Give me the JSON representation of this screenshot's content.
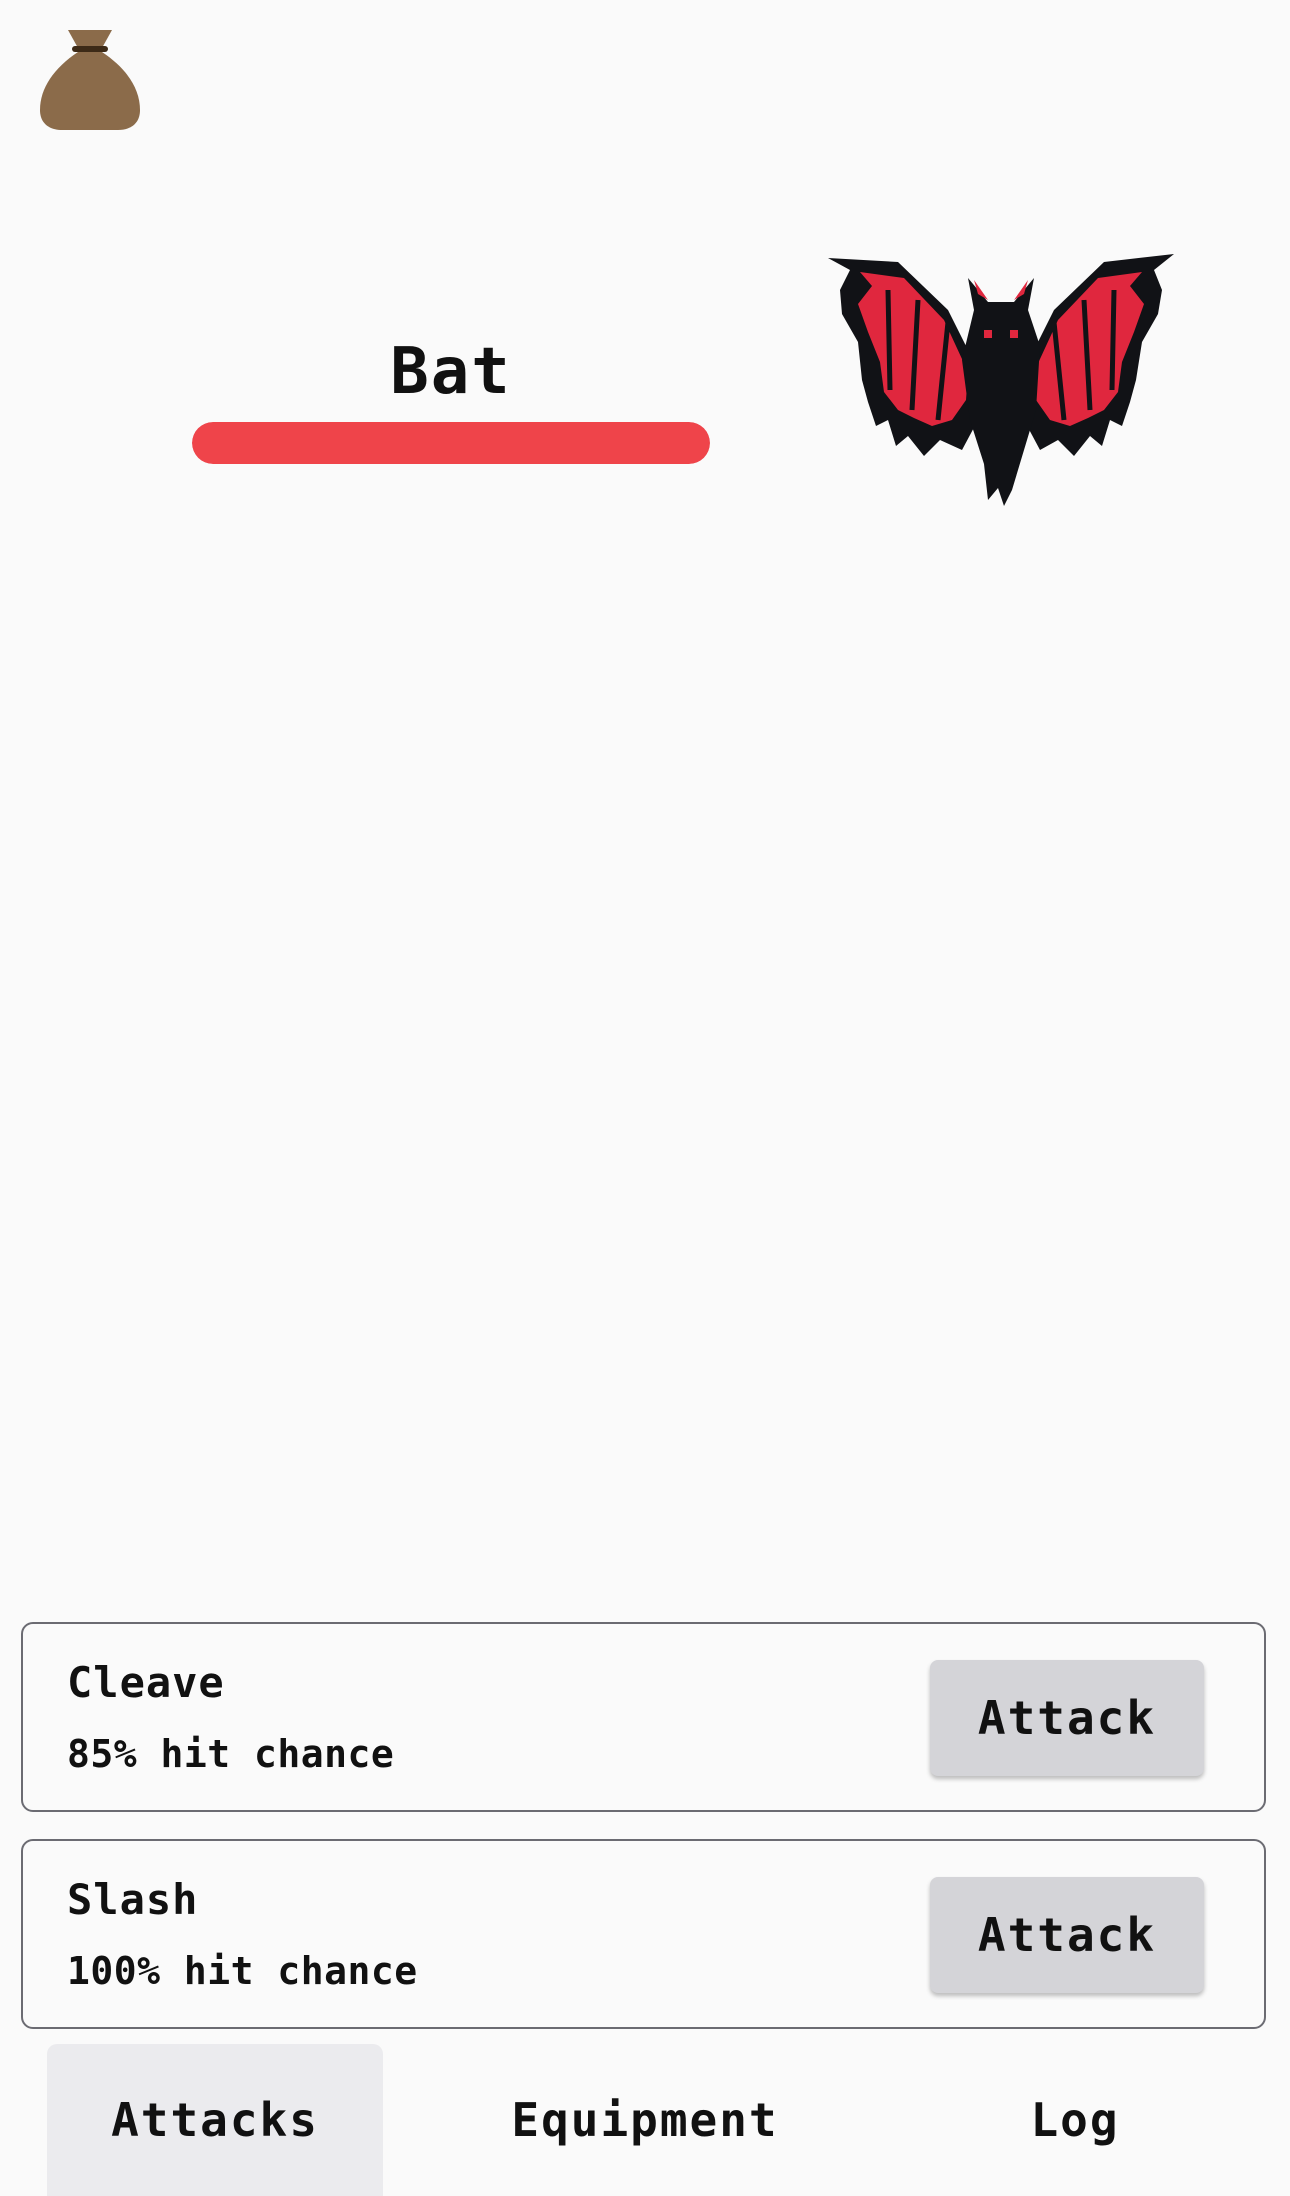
{
  "header": {
    "loot_icon": "sack-icon"
  },
  "enemy": {
    "name": "Bat",
    "health_fraction": 1.0,
    "health_color": "#ef444a",
    "sprite_icon": "bat-sprite-icon"
  },
  "attacks": [
    {
      "name": "Cleave",
      "hit_chance": "85% hit chance",
      "button_label": "Attack"
    },
    {
      "name": "Slash",
      "hit_chance": "100% hit chance",
      "button_label": "Attack"
    }
  ],
  "tabs": [
    {
      "label": "Attacks",
      "active": true
    },
    {
      "label": "Equipment",
      "active": false
    },
    {
      "label": "Log",
      "active": false
    }
  ]
}
